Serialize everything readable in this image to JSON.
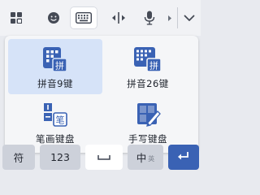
{
  "toolbar": {
    "items": [
      {
        "name": "apps-grid-icon"
      },
      {
        "name": "emoji-icon"
      },
      {
        "name": "keyboard-icon",
        "active": true
      },
      {
        "name": "cursor-move-icon"
      },
      {
        "name": "microphone-icon"
      },
      {
        "name": "more-arrow-icon"
      },
      {
        "name": "collapse-chevron-icon"
      }
    ]
  },
  "layout_menu": {
    "options": [
      {
        "label": "拼音9键",
        "icon": "pinyin-9key-icon",
        "selected": true
      },
      {
        "label": "拼音26键",
        "icon": "pinyin-26key-icon",
        "selected": false
      },
      {
        "label": "笔画键盘",
        "icon": "stroke-keyboard-icon",
        "selected": false
      },
      {
        "label": "手写键盘",
        "icon": "handwriting-keyboard-icon",
        "selected": false
      }
    ],
    "icon_glyphs": {
      "pinyin": "拼",
      "stroke": "笔"
    }
  },
  "bottom_row": {
    "symbols": "符",
    "numbers": "123",
    "space": "",
    "lang_main": "中",
    "lang_sub": "英",
    "enter": "↵"
  },
  "colors": {
    "accent": "#3a62b4",
    "selected_bg": "#d6e3f8"
  }
}
